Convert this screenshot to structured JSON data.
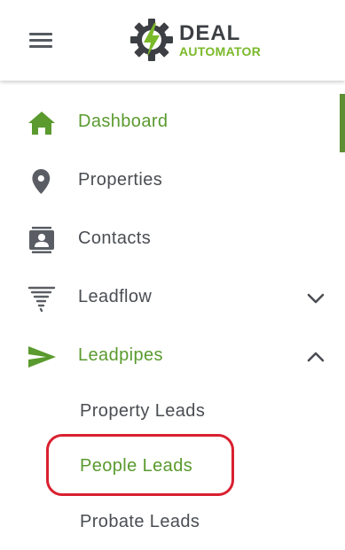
{
  "logo": {
    "line1": "DEAL",
    "line2": "AUTOMATOR"
  },
  "nav": {
    "dashboard": "Dashboard",
    "properties": "Properties",
    "contacts": "Contacts",
    "leadflow": "Leadflow",
    "leadpipes": "Leadpipes"
  },
  "leadpipes_sub": {
    "property_leads": "Property Leads",
    "people_leads": "People Leads",
    "probate_leads": "Probate Leads"
  },
  "icons": {
    "menu": "hamburger-menu-icon",
    "dashboard": "home-icon",
    "properties": "map-pin-icon",
    "contacts": "contact-card-icon",
    "leadflow": "tornado-icon",
    "leadpipes": "send-icon",
    "collapsed": "chevron-down-icon",
    "expanded": "chevron-up-icon"
  },
  "colors": {
    "accent_green": "#5a9a2e",
    "logo_green": "#7ab929",
    "text_gray": "#4a4d52",
    "highlight_red": "#d9202f"
  }
}
